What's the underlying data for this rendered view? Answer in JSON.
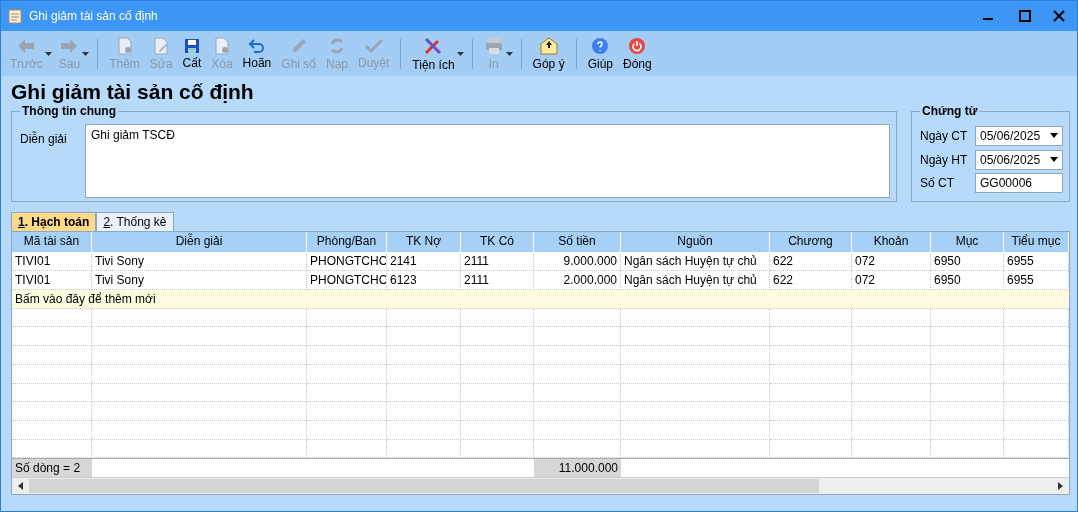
{
  "window": {
    "title": "Ghi giảm tài sản cố định"
  },
  "toolbar": [
    [
      {
        "label": "Trước",
        "disabled": true,
        "dropdown": true
      },
      {
        "label": "Sau",
        "disabled": true,
        "dropdown": true
      }
    ],
    [
      {
        "label": "Thêm",
        "disabled": true,
        "dropdown": false
      },
      {
        "label": "Sửa",
        "disabled": true,
        "dropdown": false
      },
      {
        "label": "Cất",
        "disabled": false,
        "dropdown": false
      },
      {
        "label": "Xóa",
        "disabled": true,
        "dropdown": false
      },
      {
        "label": "Hoãn",
        "disabled": false,
        "dropdown": false
      },
      {
        "label": "Ghi sổ",
        "disabled": true,
        "dropdown": false
      },
      {
        "label": "Nạp",
        "disabled": true,
        "dropdown": false
      },
      {
        "label": "Duyệt",
        "disabled": true,
        "dropdown": false
      }
    ],
    [
      {
        "label": "Tiện ích",
        "disabled": false,
        "dropdown": true
      }
    ],
    [
      {
        "label": "In",
        "disabled": true,
        "dropdown": true
      }
    ],
    [
      {
        "label": "Góp ý",
        "disabled": false,
        "dropdown": false
      }
    ],
    [
      {
        "label": "Giúp",
        "disabled": false,
        "dropdown": false
      },
      {
        "label": "Đóng",
        "disabled": false,
        "dropdown": false
      }
    ]
  ],
  "heading": "Ghi giảm tài sản cố định",
  "general": {
    "legend": "Thông tin chung",
    "label": "Diễn giải",
    "value": "Ghi giảm TSCĐ"
  },
  "voucher": {
    "legend": "Chứng từ",
    "fields": [
      {
        "label": "Ngày CT",
        "value": "05/06/2025",
        "dropdown": true
      },
      {
        "label": "Ngày HT",
        "value": "05/06/2025",
        "dropdown": true
      },
      {
        "label": "Số CT",
        "value": "GG00006",
        "dropdown": false
      }
    ]
  },
  "tabs": [
    {
      "key": "1",
      "label": ". Hạch toán",
      "selected": true
    },
    {
      "key": "2",
      "label": ". Thống kê",
      "selected": false
    }
  ],
  "table": {
    "columns": [
      "Mã tài sản",
      "Diễn giải",
      "Phòng/Ban",
      "TK Nợ",
      "TK Có",
      "Số tiền",
      "Nguồn",
      "Chương",
      "Khoản",
      "Mục",
      "Tiểu mục"
    ],
    "rows": [
      [
        "TIVI01",
        "Tivi Sony",
        "PHONGTCHC",
        "2141",
        "2111",
        "9.000.000",
        "Ngân sách Huyện tự chủ",
        "622",
        "072",
        "6950",
        "6955"
      ],
      [
        "TIVI01",
        "Tivi Sony",
        "PHONGTCHC",
        "6123",
        "2111",
        "2.000.000",
        "Ngân sách Huyện tự chủ",
        "622",
        "072",
        "6950",
        "6955"
      ]
    ],
    "add_row": "Bấm vào đây để thêm mới",
    "footer": {
      "count": "Số dòng = 2",
      "total": "11.000.000"
    }
  }
}
